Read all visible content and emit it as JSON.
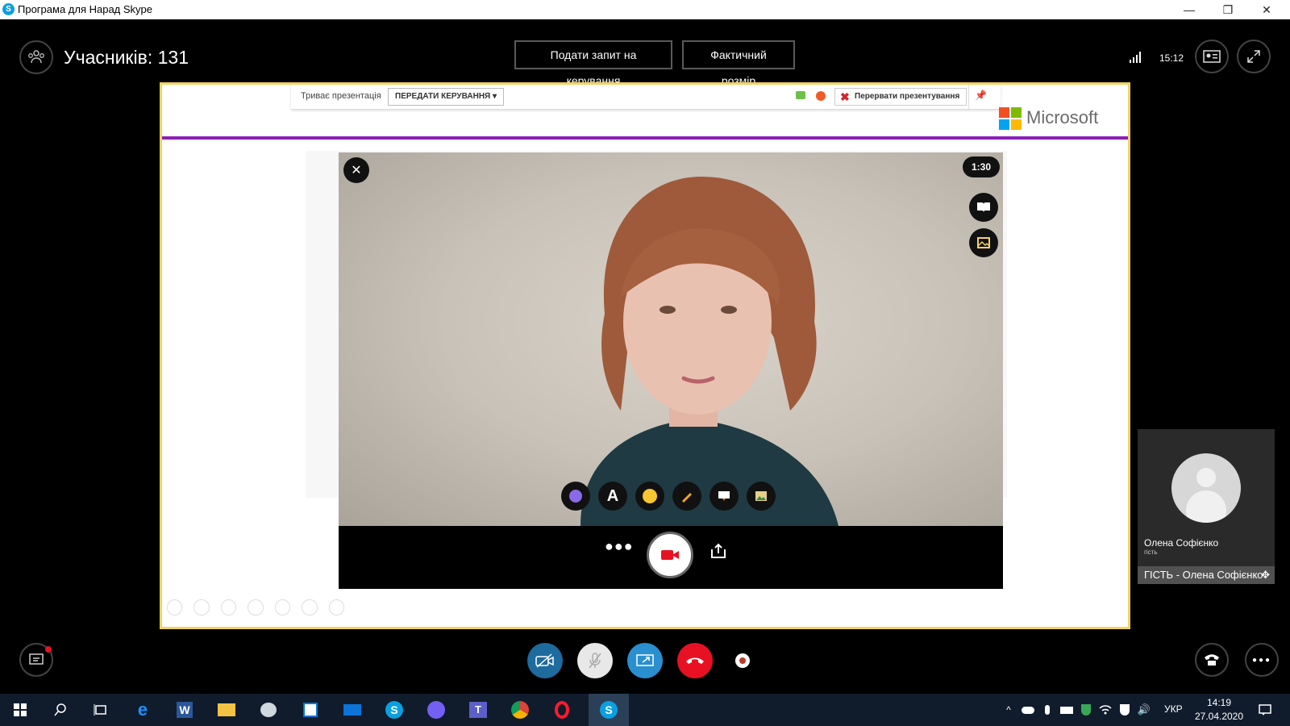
{
  "window": {
    "title": "Програма для Нарад Skype",
    "minimize": "—",
    "restore": "❐",
    "close": "✕"
  },
  "meeting": {
    "participants_label": "Учасників: 131",
    "request_control_button": "Подати запит на керування",
    "actual_size_button": "Фактичний розмір",
    "clock": "15:12"
  },
  "presentation": {
    "status_text": "Триває презентація",
    "give_control": "ПЕРЕДАТИ КЕРУВАННЯ",
    "stop_presenting": "Перервати презентування",
    "brand_text": "Microsoft"
  },
  "video": {
    "timer": "1:30"
  },
  "participant": {
    "name": "Олена Софієнко",
    "role": "гість",
    "label": "ГІСТЬ - Олена Софієнко"
  },
  "taskbar": {
    "language": "УКР",
    "time": "14:19",
    "date": "27.04.2020"
  },
  "colors": {
    "accent_purple": "#8b1fb6",
    "frame_yellow": "#f0d264",
    "hangup_red": "#e81123",
    "skype_blue": "#1a8fd6"
  }
}
